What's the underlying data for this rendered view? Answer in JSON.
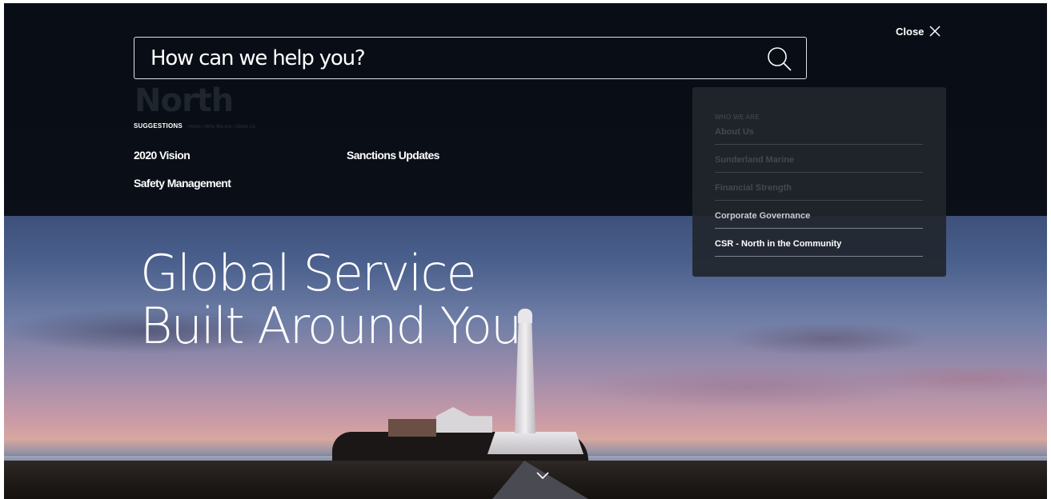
{
  "search": {
    "placeholder": "How can we help you?"
  },
  "close": {
    "label": "Close"
  },
  "brand": {
    "logo_text": "North"
  },
  "breadcrumb": {
    "text": "Home / Who We Are / About Us"
  },
  "suggestions": {
    "heading": "SUGGESTIONS",
    "items": [
      "2020 Vision",
      "Sanctions Updates",
      "Safety Management"
    ]
  },
  "menu": {
    "heading": "WHO WE ARE",
    "items": [
      "About Us",
      "Sunderland Marine",
      "Financial Strength",
      "Corporate Governance",
      "CSR - North in the Community"
    ]
  },
  "hero": {
    "line1": "Global Service",
    "line2": "Built Around You"
  },
  "colors": {
    "overlay": "#080c14",
    "text": "#ffffff",
    "menu_card": "#22262e"
  },
  "icons": {
    "search": "search-icon",
    "close": "close-icon",
    "scroll": "chevron-down-icon"
  }
}
